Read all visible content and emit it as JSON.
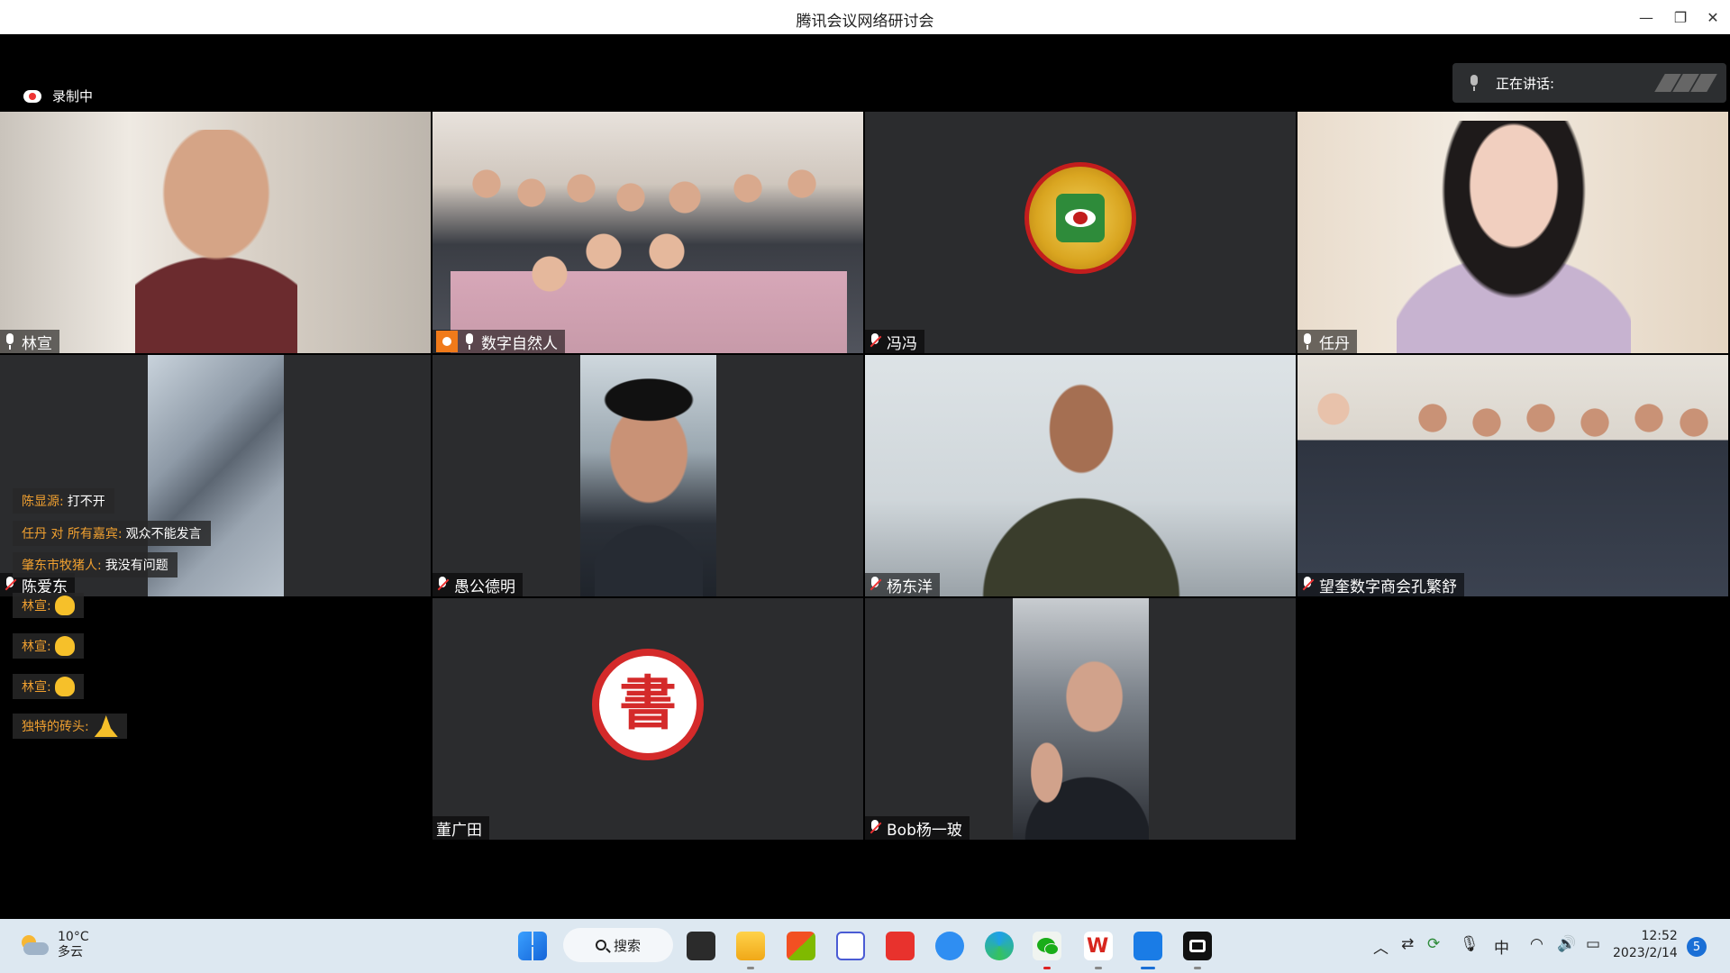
{
  "window": {
    "title": "腾讯会议网络研讨会"
  },
  "recording": {
    "label": "录制中"
  },
  "speaking": {
    "label": "正在讲话:"
  },
  "tiles": [
    {
      "name": "林宣",
      "mic": "on"
    },
    {
      "name": "数字自然人",
      "mic": "on",
      "host": true
    },
    {
      "name": "冯冯",
      "mic": "off"
    },
    {
      "name": "任丹",
      "mic": "on"
    },
    {
      "name": "陈爱东",
      "mic": "off"
    },
    {
      "name": "愚公德明",
      "mic": "off"
    },
    {
      "name": "杨东洋",
      "mic": "off"
    },
    {
      "name": "望奎数字商会孔繁舒",
      "mic": "off"
    },
    {
      "name": "董广田",
      "mic": "none"
    },
    {
      "name": "Bob杨一玻",
      "mic": "off"
    }
  ],
  "logos": {
    "stamp_char": "書"
  },
  "chat": [
    {
      "who": "陈显源:",
      "text": "打不开"
    },
    {
      "who": "任丹 对 所有嘉宾:",
      "text": "观众不能发言"
    },
    {
      "who": "肇东市牧猪人:",
      "text": "我没有问题"
    },
    {
      "who": "林宣:",
      "text": "",
      "emoji": "clap"
    },
    {
      "who": "林宣:",
      "text": "",
      "emoji": "clap"
    },
    {
      "who": "林宣:",
      "text": "",
      "emoji": "clap"
    },
    {
      "who": "独特的砖头:",
      "text": "",
      "emoji": "pray"
    }
  ],
  "taskbar": {
    "weather": {
      "temp": "10°C",
      "desc": "多云"
    },
    "search_label": "搜索",
    "ime": "中",
    "time": "12:52",
    "date": "2023/2/14",
    "notifications": "5"
  },
  "colors": {
    "tile_bg": "#2b2c2e",
    "accent_orange": "#f0a030",
    "taskbar_bg": "#dde8f1"
  }
}
